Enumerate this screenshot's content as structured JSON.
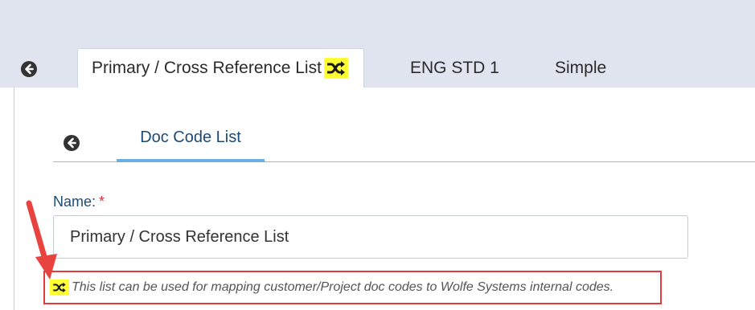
{
  "tabs": [
    {
      "label": "Primary / Cross Reference List",
      "active": true,
      "icon": "shuffle-icon"
    },
    {
      "label": "ENG STD 1",
      "active": false
    },
    {
      "label": "Simple",
      "active": false
    }
  ],
  "inner_tab": {
    "label": "Doc Code List"
  },
  "form": {
    "name_label": "Name:",
    "required_marker": "*",
    "name_value": "Primary / Cross Reference List"
  },
  "hint": {
    "text": "This list can be used for mapping customer/Project doc codes to Wolfe Systems internal codes.",
    "icon": "shuffle-icon"
  },
  "colors": {
    "highlight": "#ffff33",
    "annotation": "#e23b3b",
    "label": "#1d4a74",
    "tab_underline": "#6aaee6"
  }
}
